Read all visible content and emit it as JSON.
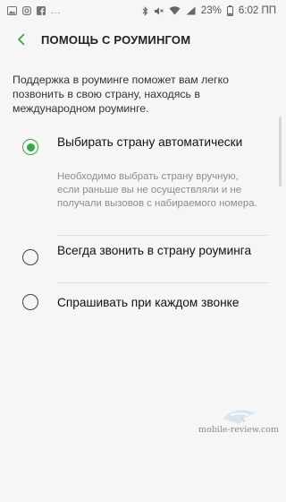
{
  "status_bar": {
    "icons_left": [
      "image-icon",
      "instagram-icon",
      "facebook-icon"
    ],
    "dots": "...",
    "icons_right": [
      "bluetooth-icon",
      "mute-icon",
      "wifi-icon",
      "signal-icon",
      "battery-icon"
    ],
    "battery": "23%",
    "time": "6:02 ПП"
  },
  "app_bar": {
    "title": "ПОМОЩЬ С РОУМИНГОМ"
  },
  "description": "Поддержка в роуминге поможет вам легко позвонить в свою страну, находясь в международном роуминге.",
  "options": [
    {
      "label": "Выбирать страну автоматически",
      "sublabel": "Необходимо выбрать страну вручную, если раньше вы не осуществляли и не получали вызовов с набираемого номера.",
      "selected": true
    },
    {
      "label": "Всегда звонить в страну роуминга",
      "selected": false
    },
    {
      "label": "Спрашивать при каждом звонке",
      "selected": false
    }
  ],
  "colors": {
    "accent": "#3aa84a",
    "background": "#f6f6f6"
  },
  "watermark": "mobile-review.com"
}
